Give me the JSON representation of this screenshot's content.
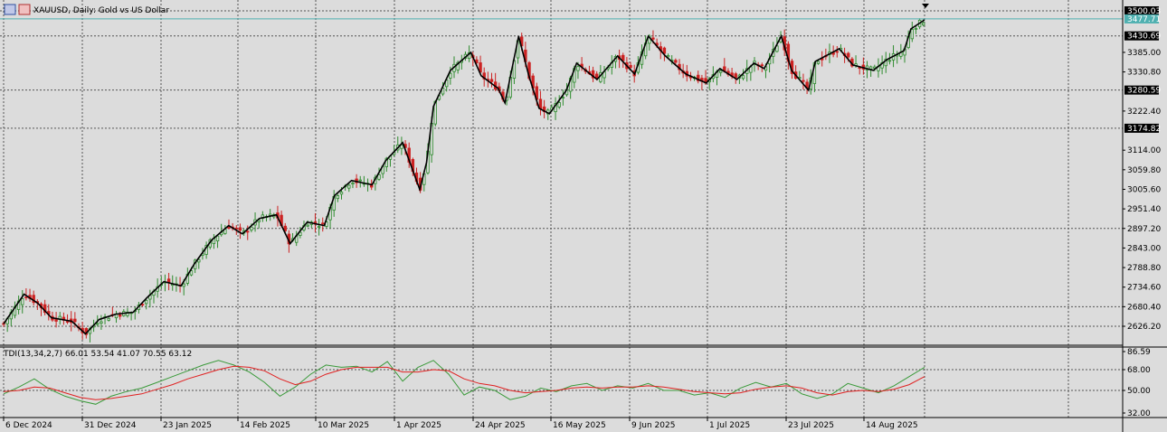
{
  "header": {
    "symbol_text": "XAUUSD, Daily:  Gold vs US Dollar",
    "indicator_text": "TDI(13,34,2,7) 66.01 53.54 41.07 70.55 63.12"
  },
  "colors": {
    "background": "#dcdcdc",
    "grid": "#555555",
    "bull_candle": "#2e8b2e",
    "bear_candle": "#cc2222",
    "smooth_line": "#000000",
    "tdi_green": "#3a9a3a",
    "tdi_red": "#e02020",
    "current_price_line": "#4fb0b0",
    "current_price_label_bg": "#4fb0b0",
    "level_label_bg": "#000000"
  },
  "chart_data": [
    {
      "type": "candlestick",
      "title": "XAUUSD, Daily:  Gold vs US Dollar",
      "x_tick_labels": [
        "6 Dec 2024",
        "31 Dec 2024",
        "23 Jan 2025",
        "14 Feb 2025",
        "10 Mar 2025",
        "1 Apr 2025",
        "24 Apr 2025",
        "16 May 2025",
        "9 Jun 2025",
        "1 Jul 2025",
        "23 Jul 2025",
        "14 Aug 2025"
      ],
      "y_tick_labels": [
        "3500.03",
        "3430.69",
        "3385.00",
        "3330.80",
        "3280.59",
        "3222.40",
        "3174.82",
        "3114.00",
        "3059.80",
        "3005.60",
        "2951.40",
        "2897.20",
        "2843.00",
        "2788.80",
        "2734.60",
        "2680.40",
        "2626.20"
      ],
      "ylim": [
        2580,
        3520
      ],
      "current_price": "3477.71",
      "level_labels": [
        "3500.03",
        "3430.69",
        "3280.59",
        "3174.82"
      ],
      "close_path": [
        [
          "2024-12-06",
          2633
        ],
        [
          "2024-12-12",
          2715
        ],
        [
          "2024-12-16",
          2690
        ],
        [
          "2024-12-20",
          2650
        ],
        [
          "2024-12-26",
          2640
        ],
        [
          "2024-12-30",
          2605
        ],
        [
          "2025-01-03",
          2645
        ],
        [
          "2025-01-08",
          2660
        ],
        [
          "2025-01-13",
          2665
        ],
        [
          "2025-01-17",
          2705
        ],
        [
          "2025-01-22",
          2750
        ],
        [
          "2025-01-27",
          2738
        ],
        [
          "2025-01-31",
          2800
        ],
        [
          "2025-02-05",
          2865
        ],
        [
          "2025-02-10",
          2905
        ],
        [
          "2025-02-14",
          2882
        ],
        [
          "2025-02-19",
          2925
        ],
        [
          "2025-02-24",
          2935
        ],
        [
          "2025-02-28",
          2855
        ],
        [
          "2025-03-05",
          2915
        ],
        [
          "2025-03-10",
          2905
        ],
        [
          "2025-03-13",
          2988
        ],
        [
          "2025-03-18",
          3030
        ],
        [
          "2025-03-24",
          3018
        ],
        [
          "2025-03-28",
          3085
        ],
        [
          "2025-04-02",
          3135
        ],
        [
          "2025-04-07",
          3005
        ],
        [
          "2025-04-09",
          3080
        ],
        [
          "2025-04-11",
          3235
        ],
        [
          "2025-04-16",
          3335
        ],
        [
          "2025-04-22",
          3385
        ],
        [
          "2025-04-25",
          3320
        ],
        [
          "2025-04-30",
          3285
        ],
        [
          "2025-05-02",
          3245
        ],
        [
          "2025-05-06",
          3430
        ],
        [
          "2025-05-09",
          3320
        ],
        [
          "2025-05-12",
          3230
        ],
        [
          "2025-05-15",
          3215
        ],
        [
          "2025-05-20",
          3280
        ],
        [
          "2025-05-23",
          3355
        ],
        [
          "2025-05-29",
          3310
        ],
        [
          "2025-06-04",
          3375
        ],
        [
          "2025-06-09",
          3325
        ],
        [
          "2025-06-13",
          3430
        ],
        [
          "2025-06-18",
          3375
        ],
        [
          "2025-06-24",
          3325
        ],
        [
          "2025-06-30",
          3300
        ],
        [
          "2025-07-04",
          3340
        ],
        [
          "2025-07-09",
          3310
        ],
        [
          "2025-07-14",
          3355
        ],
        [
          "2025-07-17",
          3340
        ],
        [
          "2025-07-22",
          3430
        ],
        [
          "2025-07-25",
          3335
        ],
        [
          "2025-07-30",
          3280
        ],
        [
          "2025-08-01",
          3360
        ],
        [
          "2025-08-05",
          3380
        ],
        [
          "2025-08-08",
          3395
        ],
        [
          "2025-08-12",
          3350
        ],
        [
          "2025-08-18",
          3335
        ],
        [
          "2025-08-22",
          3365
        ],
        [
          "2025-08-27",
          3390
        ],
        [
          "2025-08-29",
          3450
        ],
        [
          "2025-09-02",
          3475
        ]
      ]
    },
    {
      "type": "line",
      "title": "TDI(13,34,2,7) 66.01 53.54 41.07 70.55 63.12",
      "y_tick_labels": [
        "86.59",
        "68.00",
        "50.00",
        "32.00"
      ],
      "ylim": [
        32,
        86.59
      ],
      "series": [
        {
          "role": "price_line",
          "color": "#3a9a3a",
          "values": [
            47,
            53,
            60,
            51,
            45,
            41,
            38,
            45,
            49,
            52,
            57,
            62,
            67,
            72,
            76,
            72,
            66,
            57,
            45,
            53,
            64,
            72,
            70,
            71,
            66,
            75,
            58,
            70,
            76,
            64,
            46,
            53,
            50,
            42,
            45,
            52,
            49,
            54,
            56,
            50,
            54,
            52,
            56,
            50,
            50,
            46,
            48,
            44,
            52,
            57,
            53,
            56,
            47,
            43,
            47,
            56,
            52,
            48,
            54,
            62,
            70
          ]
        },
        {
          "role": "signal_line",
          "color": "#e02020",
          "values": [
            49,
            50,
            53,
            52,
            48,
            44,
            42,
            43,
            45,
            47,
            51,
            55,
            60,
            64,
            68,
            71,
            70,
            67,
            60,
            55,
            58,
            64,
            68,
            70,
            70,
            70,
            66,
            66,
            68,
            67,
            60,
            56,
            54,
            50,
            48,
            49,
            50,
            52,
            53,
            52,
            53,
            53,
            54,
            53,
            51,
            49,
            48,
            47,
            48,
            51,
            53,
            54,
            52,
            48,
            46,
            49,
            50,
            49,
            51,
            55,
            62
          ]
        }
      ]
    }
  ]
}
